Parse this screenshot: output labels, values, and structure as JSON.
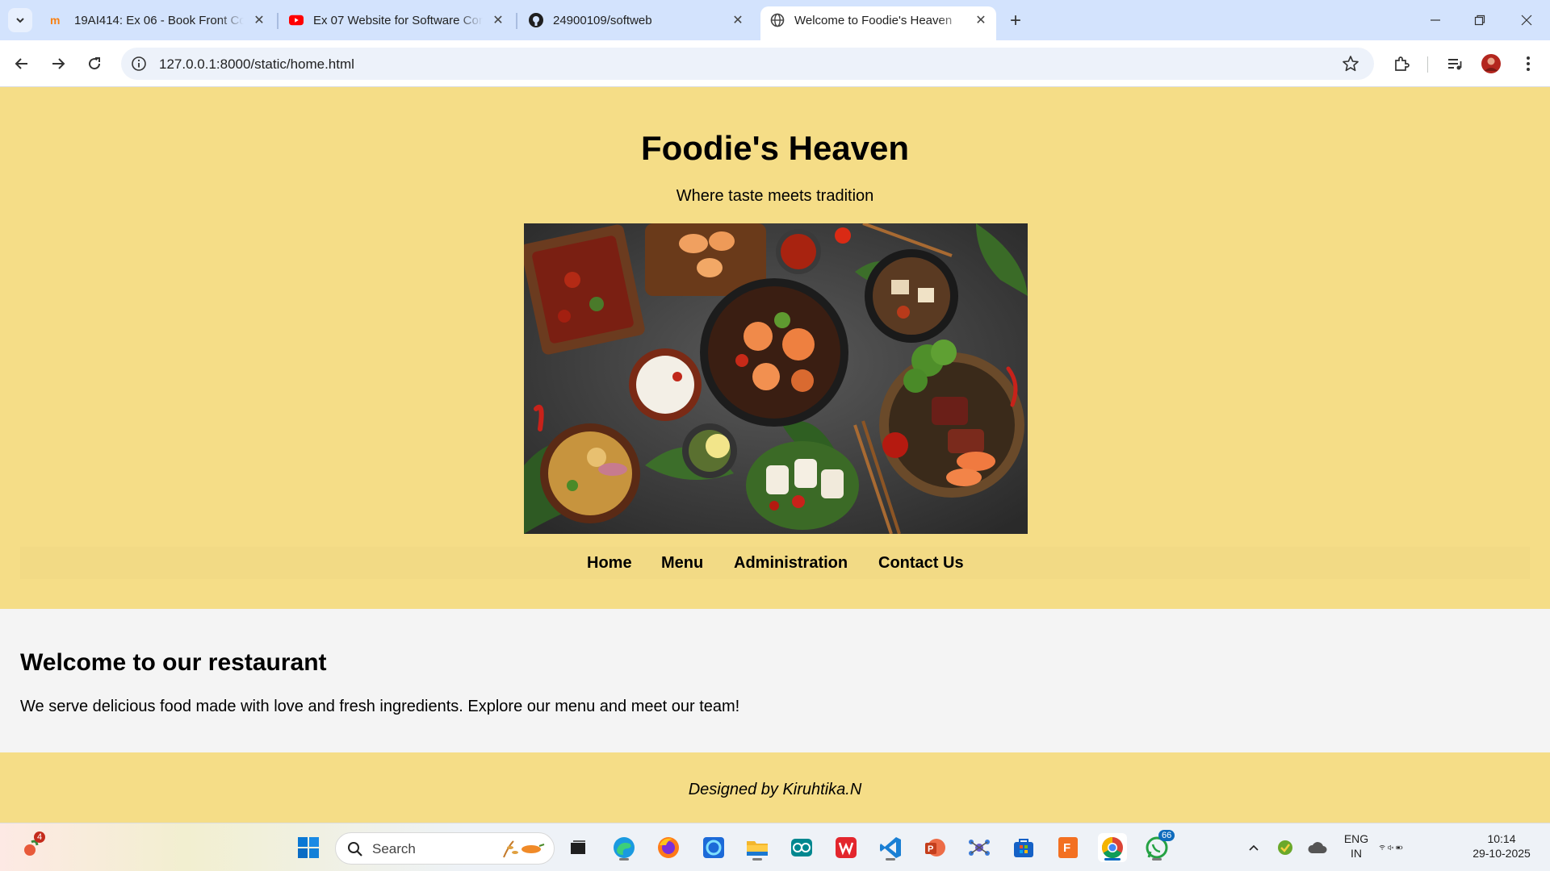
{
  "browser": {
    "tabs": [
      {
        "title": "19AI414: Ex 06 - Book Front Cover",
        "favicon": "moodle-icon"
      },
      {
        "title": "Ex 07 Website for Software Company",
        "favicon": "youtube-icon"
      },
      {
        "title": "24900109/softweb",
        "favicon": "github-icon"
      },
      {
        "title": "Welcome to Foodie's Heaven",
        "favicon": "globe-icon",
        "active": true
      }
    ],
    "url": "127.0.0.1:8000/static/home.html"
  },
  "page": {
    "site_title": "Foodie's Heaven",
    "tagline": "Where taste meets tradition",
    "nav": [
      "Home",
      "Menu",
      "Administration",
      "Contact Us"
    ],
    "welcome_heading": "Welcome to our restaurant",
    "welcome_text": "We serve delicious food made with love and fresh ingredients. Explore our menu and meet our team!",
    "footer_credit": "Designed by Kiruhtika.N",
    "colors": {
      "header_bg": "#f5dd87",
      "body_bg": "#f4f4f4"
    }
  },
  "taskbar": {
    "search_placeholder": "Search",
    "notification_count": "4",
    "whatsapp_badge": "66",
    "language": "ENG",
    "region": "IN",
    "time": "10:14",
    "date": "29-10-2025"
  }
}
